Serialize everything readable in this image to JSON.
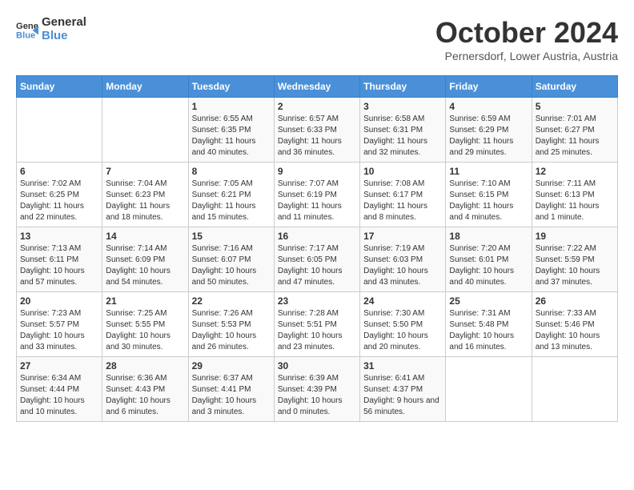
{
  "logo": {
    "line1": "General",
    "line2": "Blue"
  },
  "title": "October 2024",
  "subtitle": "Pernersdorf, Lower Austria, Austria",
  "weekdays": [
    "Sunday",
    "Monday",
    "Tuesday",
    "Wednesday",
    "Thursday",
    "Friday",
    "Saturday"
  ],
  "weeks": [
    [
      {
        "day": "",
        "sunrise": "",
        "sunset": "",
        "daylight": ""
      },
      {
        "day": "",
        "sunrise": "",
        "sunset": "",
        "daylight": ""
      },
      {
        "day": "1",
        "sunrise": "Sunrise: 6:55 AM",
        "sunset": "Sunset: 6:35 PM",
        "daylight": "Daylight: 11 hours and 40 minutes."
      },
      {
        "day": "2",
        "sunrise": "Sunrise: 6:57 AM",
        "sunset": "Sunset: 6:33 PM",
        "daylight": "Daylight: 11 hours and 36 minutes."
      },
      {
        "day": "3",
        "sunrise": "Sunrise: 6:58 AM",
        "sunset": "Sunset: 6:31 PM",
        "daylight": "Daylight: 11 hours and 32 minutes."
      },
      {
        "day": "4",
        "sunrise": "Sunrise: 6:59 AM",
        "sunset": "Sunset: 6:29 PM",
        "daylight": "Daylight: 11 hours and 29 minutes."
      },
      {
        "day": "5",
        "sunrise": "Sunrise: 7:01 AM",
        "sunset": "Sunset: 6:27 PM",
        "daylight": "Daylight: 11 hours and 25 minutes."
      }
    ],
    [
      {
        "day": "6",
        "sunrise": "Sunrise: 7:02 AM",
        "sunset": "Sunset: 6:25 PM",
        "daylight": "Daylight: 11 hours and 22 minutes."
      },
      {
        "day": "7",
        "sunrise": "Sunrise: 7:04 AM",
        "sunset": "Sunset: 6:23 PM",
        "daylight": "Daylight: 11 hours and 18 minutes."
      },
      {
        "day": "8",
        "sunrise": "Sunrise: 7:05 AM",
        "sunset": "Sunset: 6:21 PM",
        "daylight": "Daylight: 11 hours and 15 minutes."
      },
      {
        "day": "9",
        "sunrise": "Sunrise: 7:07 AM",
        "sunset": "Sunset: 6:19 PM",
        "daylight": "Daylight: 11 hours and 11 minutes."
      },
      {
        "day": "10",
        "sunrise": "Sunrise: 7:08 AM",
        "sunset": "Sunset: 6:17 PM",
        "daylight": "Daylight: 11 hours and 8 minutes."
      },
      {
        "day": "11",
        "sunrise": "Sunrise: 7:10 AM",
        "sunset": "Sunset: 6:15 PM",
        "daylight": "Daylight: 11 hours and 4 minutes."
      },
      {
        "day": "12",
        "sunrise": "Sunrise: 7:11 AM",
        "sunset": "Sunset: 6:13 PM",
        "daylight": "Daylight: 11 hours and 1 minute."
      }
    ],
    [
      {
        "day": "13",
        "sunrise": "Sunrise: 7:13 AM",
        "sunset": "Sunset: 6:11 PM",
        "daylight": "Daylight: 10 hours and 57 minutes."
      },
      {
        "day": "14",
        "sunrise": "Sunrise: 7:14 AM",
        "sunset": "Sunset: 6:09 PM",
        "daylight": "Daylight: 10 hours and 54 minutes."
      },
      {
        "day": "15",
        "sunrise": "Sunrise: 7:16 AM",
        "sunset": "Sunset: 6:07 PM",
        "daylight": "Daylight: 10 hours and 50 minutes."
      },
      {
        "day": "16",
        "sunrise": "Sunrise: 7:17 AM",
        "sunset": "Sunset: 6:05 PM",
        "daylight": "Daylight: 10 hours and 47 minutes."
      },
      {
        "day": "17",
        "sunrise": "Sunrise: 7:19 AM",
        "sunset": "Sunset: 6:03 PM",
        "daylight": "Daylight: 10 hours and 43 minutes."
      },
      {
        "day": "18",
        "sunrise": "Sunrise: 7:20 AM",
        "sunset": "Sunset: 6:01 PM",
        "daylight": "Daylight: 10 hours and 40 minutes."
      },
      {
        "day": "19",
        "sunrise": "Sunrise: 7:22 AM",
        "sunset": "Sunset: 5:59 PM",
        "daylight": "Daylight: 10 hours and 37 minutes."
      }
    ],
    [
      {
        "day": "20",
        "sunrise": "Sunrise: 7:23 AM",
        "sunset": "Sunset: 5:57 PM",
        "daylight": "Daylight: 10 hours and 33 minutes."
      },
      {
        "day": "21",
        "sunrise": "Sunrise: 7:25 AM",
        "sunset": "Sunset: 5:55 PM",
        "daylight": "Daylight: 10 hours and 30 minutes."
      },
      {
        "day": "22",
        "sunrise": "Sunrise: 7:26 AM",
        "sunset": "Sunset: 5:53 PM",
        "daylight": "Daylight: 10 hours and 26 minutes."
      },
      {
        "day": "23",
        "sunrise": "Sunrise: 7:28 AM",
        "sunset": "Sunset: 5:51 PM",
        "daylight": "Daylight: 10 hours and 23 minutes."
      },
      {
        "day": "24",
        "sunrise": "Sunrise: 7:30 AM",
        "sunset": "Sunset: 5:50 PM",
        "daylight": "Daylight: 10 hours and 20 minutes."
      },
      {
        "day": "25",
        "sunrise": "Sunrise: 7:31 AM",
        "sunset": "Sunset: 5:48 PM",
        "daylight": "Daylight: 10 hours and 16 minutes."
      },
      {
        "day": "26",
        "sunrise": "Sunrise: 7:33 AM",
        "sunset": "Sunset: 5:46 PM",
        "daylight": "Daylight: 10 hours and 13 minutes."
      }
    ],
    [
      {
        "day": "27",
        "sunrise": "Sunrise: 6:34 AM",
        "sunset": "Sunset: 4:44 PM",
        "daylight": "Daylight: 10 hours and 10 minutes."
      },
      {
        "day": "28",
        "sunrise": "Sunrise: 6:36 AM",
        "sunset": "Sunset: 4:43 PM",
        "daylight": "Daylight: 10 hours and 6 minutes."
      },
      {
        "day": "29",
        "sunrise": "Sunrise: 6:37 AM",
        "sunset": "Sunset: 4:41 PM",
        "daylight": "Daylight: 10 hours and 3 minutes."
      },
      {
        "day": "30",
        "sunrise": "Sunrise: 6:39 AM",
        "sunset": "Sunset: 4:39 PM",
        "daylight": "Daylight: 10 hours and 0 minutes."
      },
      {
        "day": "31",
        "sunrise": "Sunrise: 6:41 AM",
        "sunset": "Sunset: 4:37 PM",
        "daylight": "Daylight: 9 hours and 56 minutes."
      },
      {
        "day": "",
        "sunrise": "",
        "sunset": "",
        "daylight": ""
      },
      {
        "day": "",
        "sunrise": "",
        "sunset": "",
        "daylight": ""
      }
    ]
  ]
}
